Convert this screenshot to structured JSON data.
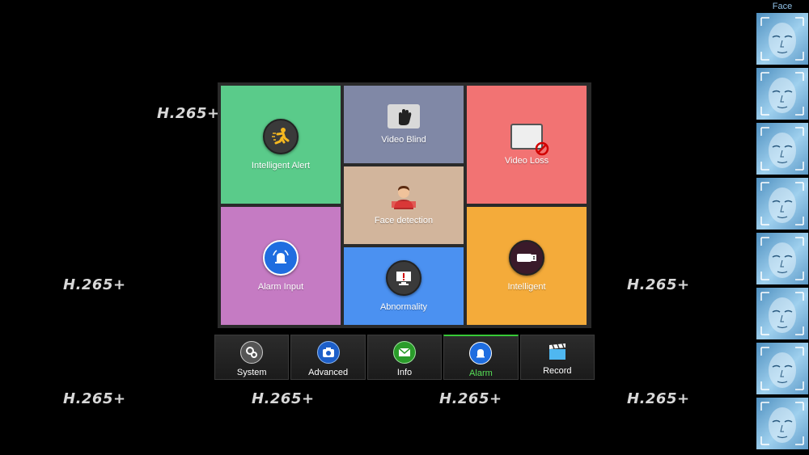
{
  "watermarks": {
    "w1": "H.265+",
    "w2": "H.265+",
    "w3": "H.265+",
    "w4": "H.265+",
    "w5": "H.265+",
    "w6": "H.265+",
    "w7": "H.265+"
  },
  "tiles": {
    "intelligent_alert": "Intelligent Alert",
    "video_blind": "Video Blind",
    "video_loss": "Video Loss",
    "face_detection": "Face detection",
    "alarm_input": "Alarm Input",
    "abnormality": "Abnormality",
    "intelligent": "Intelligent"
  },
  "tile_colors": {
    "intelligent_alert": "#5acb8a",
    "video_blind": "#8088a6",
    "video_loss": "#f27373",
    "face_detection": "#d2b59c",
    "alarm_input": "#c57bc3",
    "abnormality": "#4b91f1",
    "intelligent": "#f4ab3a"
  },
  "menu": {
    "system": "System",
    "advanced": "Advanced",
    "info": "Info",
    "alarm": "Alarm",
    "record": "Record",
    "active": "Alarm"
  },
  "facebar": {
    "title": "Face",
    "count": 8
  }
}
